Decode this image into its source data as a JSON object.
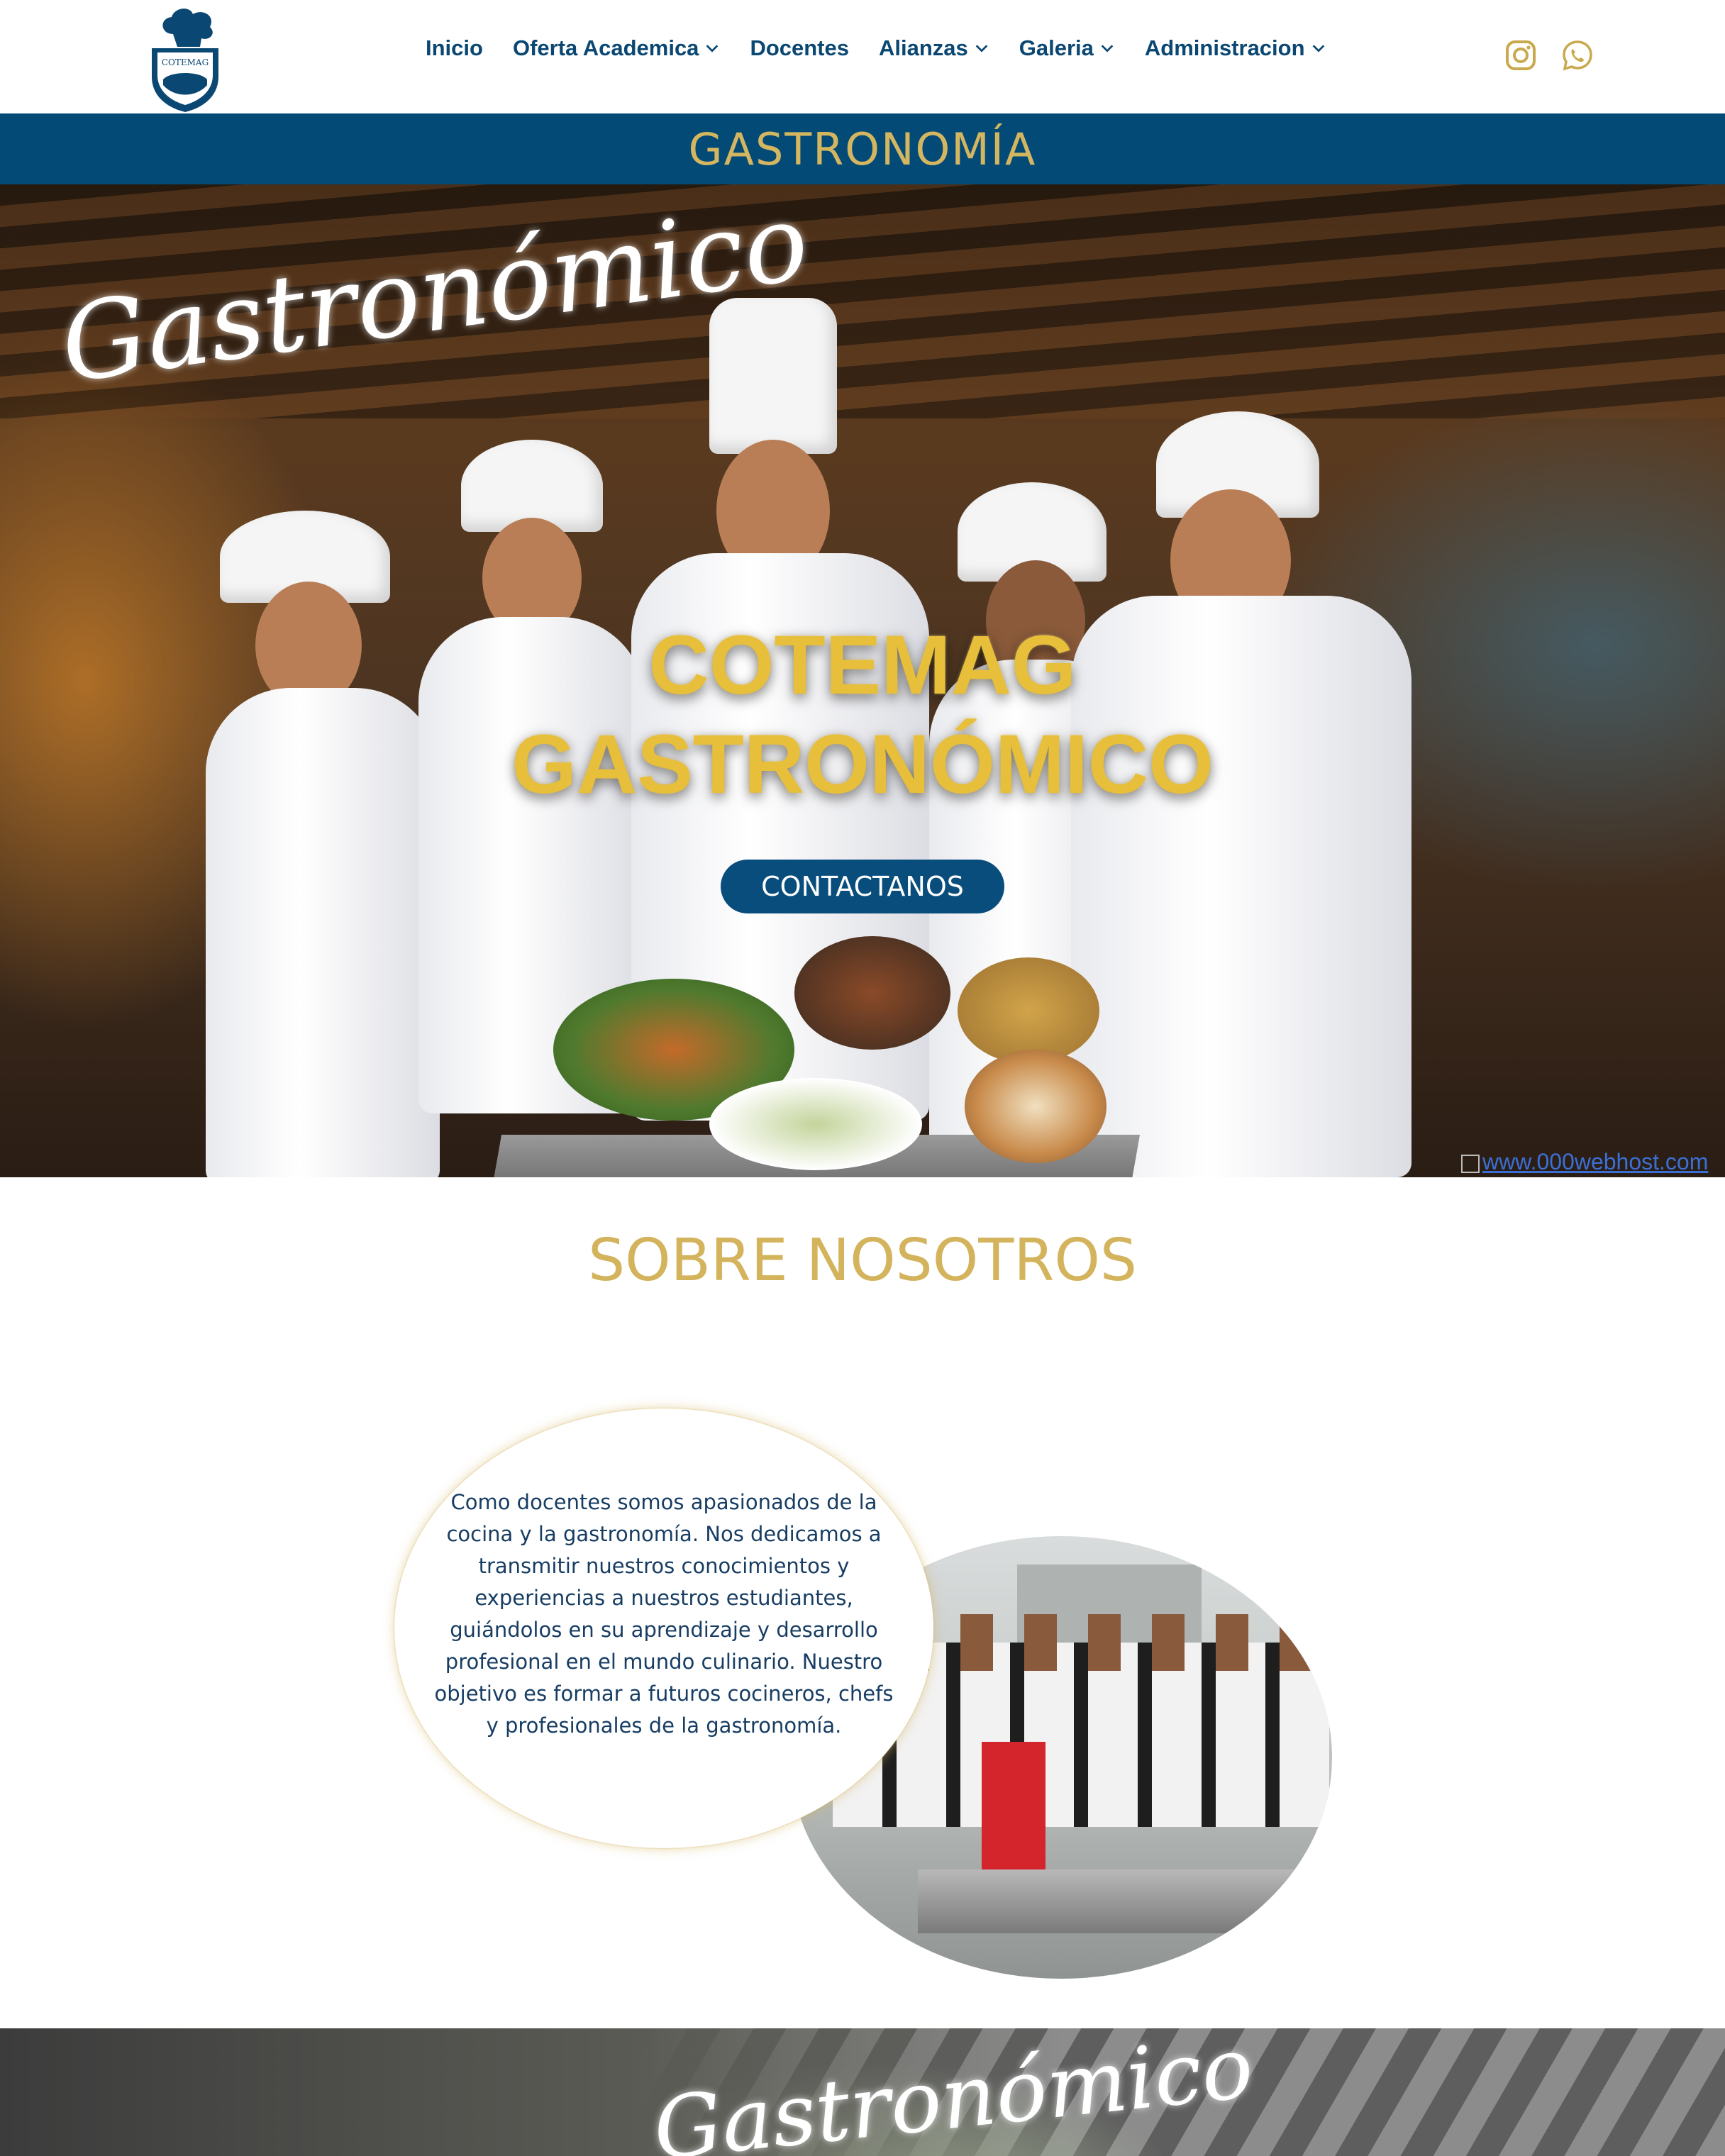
{
  "header": {
    "logo_text": "COTEMAG",
    "nav": [
      {
        "label": "Inicio",
        "has_dropdown": false
      },
      {
        "label": "Oferta Academica",
        "has_dropdown": true
      },
      {
        "label": "Docentes",
        "has_dropdown": false
      },
      {
        "label": "Alianzas",
        "has_dropdown": true
      },
      {
        "label": "Galeria",
        "has_dropdown": true
      },
      {
        "label": "Administracion",
        "has_dropdown": true
      }
    ],
    "social": [
      "instagram-icon",
      "whatsapp-icon"
    ],
    "icon_color": "#c9a94e"
  },
  "title_bar": {
    "title": "GASTRONOMÍA",
    "bg_color": "#034a77",
    "text_color": "#d4b660"
  },
  "hero": {
    "script_text": "Gastronómico",
    "headline_line1": "COTEMAG",
    "headline_line2": "GASTRONÓMICO",
    "cta_label": "CONTACTANOS",
    "broken_image_alt": "www.000webhost.com"
  },
  "about": {
    "title": "SOBRE NOSOTROS",
    "text": "Como docentes somos apasionados de la cocina y la gastronomía. Nos dedicamos a transmitir nuestros conocimientos y experiencias a nuestros estudiantes, guiándolos en su aprendizaje y desarrollo profesional en el mundo culinario. Nuestro objetivo es formar a futuros cocineros, chefs y profesionales de la gastronomía."
  },
  "bottom_banner": {
    "script_text": "Gastronómico"
  }
}
